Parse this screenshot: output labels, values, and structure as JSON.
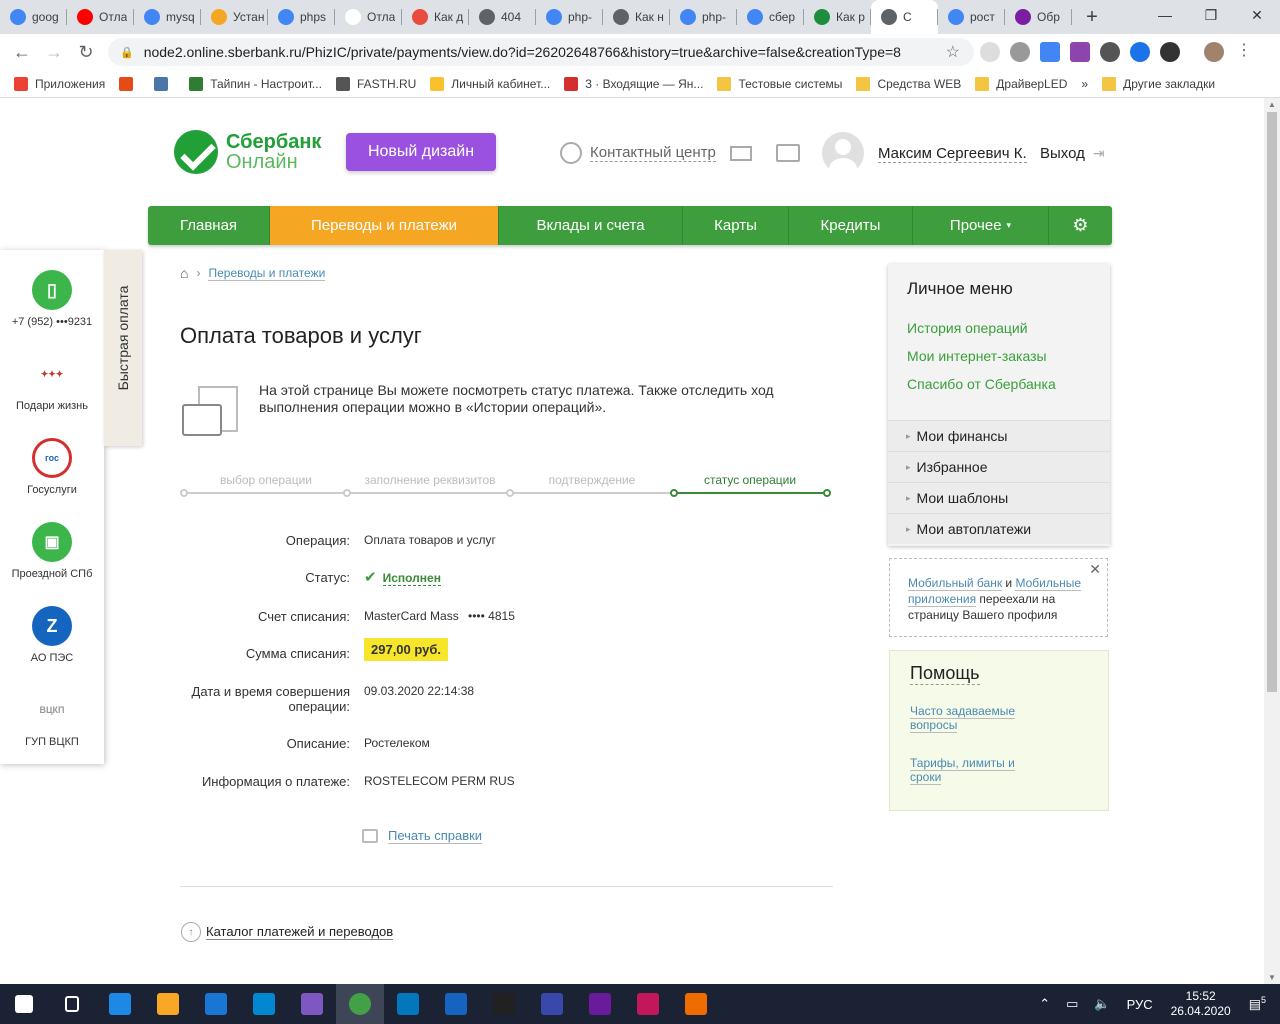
{
  "browser": {
    "tabs": [
      {
        "title": "goog",
        "icon": "google-icon",
        "color": "#4285f4"
      },
      {
        "title": "Отла",
        "icon": "youtube-icon",
        "color": "#ff0000"
      },
      {
        "title": "mysq",
        "icon": "google-icon",
        "color": "#4285f4"
      },
      {
        "title": "Устан",
        "icon": "orange-site-icon",
        "color": "#f5a623"
      },
      {
        "title": "phps",
        "icon": "google-icon",
        "color": "#4285f4"
      },
      {
        "title": "Отла",
        "icon": "wiki-w-icon",
        "color": "#ffffff"
      },
      {
        "title": "Как д",
        "icon": "pinwheel-icon",
        "color": "#e74c3c"
      },
      {
        "title": "404",
        "icon": "globe-icon",
        "color": "#5f6368"
      },
      {
        "title": "php-",
        "icon": "google-icon",
        "color": "#4285f4"
      },
      {
        "title": "Как н",
        "icon": "y-site-icon",
        "color": "#5f6368"
      },
      {
        "title": "php-",
        "icon": "google-icon",
        "color": "#4285f4"
      },
      {
        "title": "сбер",
        "icon": "google-icon",
        "color": "#4285f4"
      },
      {
        "title": "Как р",
        "icon": "green-square-icon",
        "color": "#1e8e3e"
      },
      {
        "title": "С",
        "icon": "globe-icon",
        "color": "#5f6368"
      },
      {
        "title": "рост",
        "icon": "google-icon",
        "color": "#4285f4"
      },
      {
        "title": "Обр",
        "icon": "feather-icon",
        "color": "#7b1fa2"
      }
    ],
    "url": "node2.online.sberbank.ru/PhizIC/private/payments/view.do?id=26202648766&history=true&archive=false&creationType=8",
    "bookmarks": [
      {
        "label": "Приложения",
        "icon": "apps-grid-icon"
      },
      {
        "label": "",
        "icon": "fire-icon"
      },
      {
        "label": "",
        "icon": "vk-icon"
      },
      {
        "label": "Тайпин - Настроит...",
        "icon": "taipin-icon"
      },
      {
        "label": "FASTH.RU",
        "icon": "globe-icon"
      },
      {
        "label": "Личный кабинет...",
        "icon": "bulb-icon"
      },
      {
        "label": "3 · Входящие — Ян...",
        "icon": "mail-icon"
      },
      {
        "label": "Тестовые системы",
        "icon": "folder-icon"
      },
      {
        "label": "Средства WEB",
        "icon": "folder-icon"
      },
      {
        "label": "ДрайверLED",
        "icon": "folder-icon"
      },
      {
        "label": "»",
        "icon": ""
      },
      {
        "label": "Другие закладки",
        "icon": "folder-icon"
      }
    ]
  },
  "header": {
    "logo_line1": "Сбербанк",
    "logo_line2": "Онлайн",
    "new_design_button": "Новый дизайн",
    "contact_center": "Контактный центр",
    "user_name": "Максим Сергеевич К.",
    "logout": "Выход"
  },
  "nav": [
    {
      "label": "Главная",
      "active": false
    },
    {
      "label": "Переводы и платежи",
      "active": true
    },
    {
      "label": "Вклады и счета",
      "active": false
    },
    {
      "label": "Карты",
      "active": false
    },
    {
      "label": "Кредиты",
      "active": false
    },
    {
      "label": "Прочее",
      "active": false
    }
  ],
  "breadcrumb": {
    "current": "Переводы и платежи"
  },
  "quick_pay": {
    "tab_label": "Быстрая оплата",
    "items": [
      {
        "label": "+7 (952) •••9231",
        "icon": "phone-icon"
      },
      {
        "label": "Подари жизнь",
        "icon": "podari-zhizn-logo-icon"
      },
      {
        "label": "Госуслуги",
        "icon": "gosuslugi-logo-icon"
      },
      {
        "label": "Проездной СПб",
        "icon": "bus-icon"
      },
      {
        "label": "АО ПЭС",
        "icon": "pes-logo-icon"
      },
      {
        "label": "ГУП ВЦКП",
        "icon": "vckp-logo-icon"
      }
    ]
  },
  "main": {
    "title": "Оплата товаров и услуг",
    "info_text": "На этой странице Вы можете посмотреть статус платежа. Также отследить ход выполнения операции можно в «Истории операций».",
    "steps": [
      "выбор операции",
      "заполнение реквизитов",
      "подтверждение",
      "статус операции"
    ],
    "current_step": 3,
    "fields": {
      "operation_label": "Операция:",
      "operation_value": "Оплата товаров и услуг",
      "status_label": "Статус:",
      "status_value": "Исполнен",
      "account_label": "Счет списания:",
      "account_value": "MasterCard Mass",
      "account_mask": "•••• 4815",
      "amount_label": "Сумма списания:",
      "amount_value": "297,00 руб.",
      "datetime_label_1": "Дата и время совершения",
      "datetime_label_2": "операции:",
      "datetime_value": "09.03.2020 22:14:38",
      "description_label": "Описание:",
      "description_value": "Ростелеком",
      "payment_info_label": "Информация о платеже:",
      "payment_info_value": "ROSTELECOM PERM RUS"
    },
    "print_link": "Печать справки",
    "catalog_link": "Каталог платежей и переводов"
  },
  "personal_menu": {
    "title": "Личное меню",
    "links": [
      "История операций",
      "Мои интернет-заказы",
      "Спасибо от Сбербанка"
    ],
    "sections": [
      "Мои финансы",
      "Избранное",
      "Мои шаблоны",
      "Мои автоплатежи"
    ]
  },
  "notice": {
    "link1": "Мобильный банк",
    "and": " и ",
    "link2": "Мобильные приложения",
    "rest": " переехали на страницу Вашего профиля"
  },
  "help": {
    "title": "Помощь",
    "faq": "Часто задаваемые вопросы",
    "tariffs": "Тарифы, лимиты и сроки"
  },
  "taskbar": {
    "apps": [
      "start-icon",
      "task-view-icon",
      "edge-icon",
      "file-explorer-icon",
      "store-icon",
      "mail-icon",
      "network-app-icon",
      "chrome-icon",
      "rdp-icon",
      "virtualbox-icon",
      "terminal-icon",
      "calculator-icon",
      "podcast-icon",
      "phpstorm-icon",
      "paint-icon"
    ],
    "lang": "РУС",
    "time": "15:52",
    "date": "26.04.2020",
    "notifications": "5"
  },
  "colors": {
    "brand_green": "#3e9e3e",
    "nav_active_orange": "#f5a623",
    "new_design_purple": "#9b51e0",
    "amount_highlight": "#f7e52c"
  }
}
